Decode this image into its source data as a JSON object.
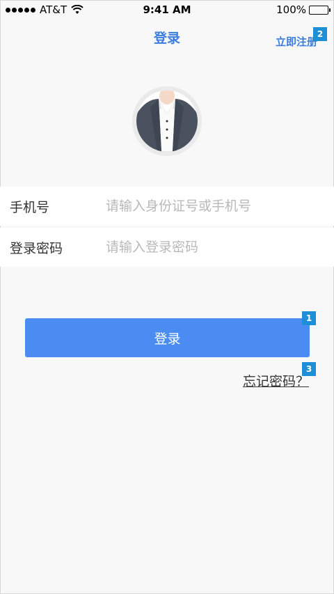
{
  "status_bar": {
    "carrier": "AT&T",
    "time": "9:41 AM",
    "battery": "100%"
  },
  "nav": {
    "title": "登录",
    "register_label": "立即注册"
  },
  "avatar": {
    "icon": "user-avatar"
  },
  "form": {
    "phone_label": "手机号",
    "phone_placeholder": "请输入身份证号或手机号",
    "password_label": "登录密码",
    "password_placeholder": "请输入登录密码"
  },
  "login_button_label": "登录",
  "forgot_label": "忘记密码？",
  "badges": {
    "login": "1",
    "register": "2",
    "forgot": "3"
  },
  "colors": {
    "accent": "#4a8cf1",
    "link": "#3b7ddd",
    "badge": "#1e8fd6",
    "background": "#f8f8f8"
  }
}
